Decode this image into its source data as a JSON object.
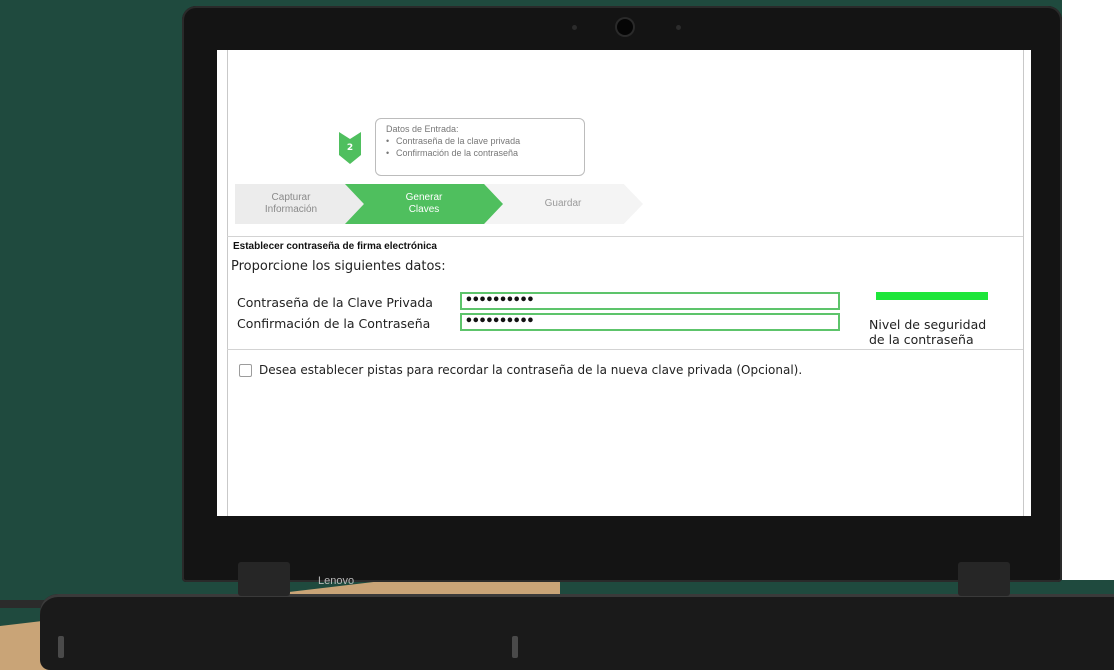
{
  "device": {
    "brand": "Lenovo"
  },
  "wizard": {
    "tooltip": {
      "title": "Datos de Entrada:",
      "items": [
        "Contraseña de la clave privada",
        "Confirmación de la contraseña"
      ]
    },
    "current_step_number": "2",
    "steps": [
      {
        "label_line1": "Capturar",
        "label_line2": "Información",
        "state": "done"
      },
      {
        "label_line1": "Generar",
        "label_line2": "Claves",
        "state": "active"
      },
      {
        "label_line1": "Guardar",
        "label_line2": "",
        "state": "pending"
      }
    ]
  },
  "form": {
    "section_title": "Establecer contraseña de firma electrónica",
    "instructions": "Proporcione los siguientes datos:",
    "private_key_password": {
      "label": "Contraseña de la Clave Privada",
      "value": "••••••••••"
    },
    "password_confirmation": {
      "label": "Confirmación de la Contraseña",
      "value": "••••••••••"
    },
    "strength": {
      "label_line1": "Nivel de seguridad",
      "label_line2": "de la contraseña",
      "color": "#1ee63a",
      "level": 1.0
    },
    "hints_checkbox": {
      "label": "Desea establecer pistas para recordar la contraseña de la nueva clave privada (Opcional).",
      "checked": false
    }
  },
  "colors": {
    "accent_green": "#4fbf5e",
    "background_green": "#1f4a3e",
    "background_tan": "#c9a477"
  }
}
